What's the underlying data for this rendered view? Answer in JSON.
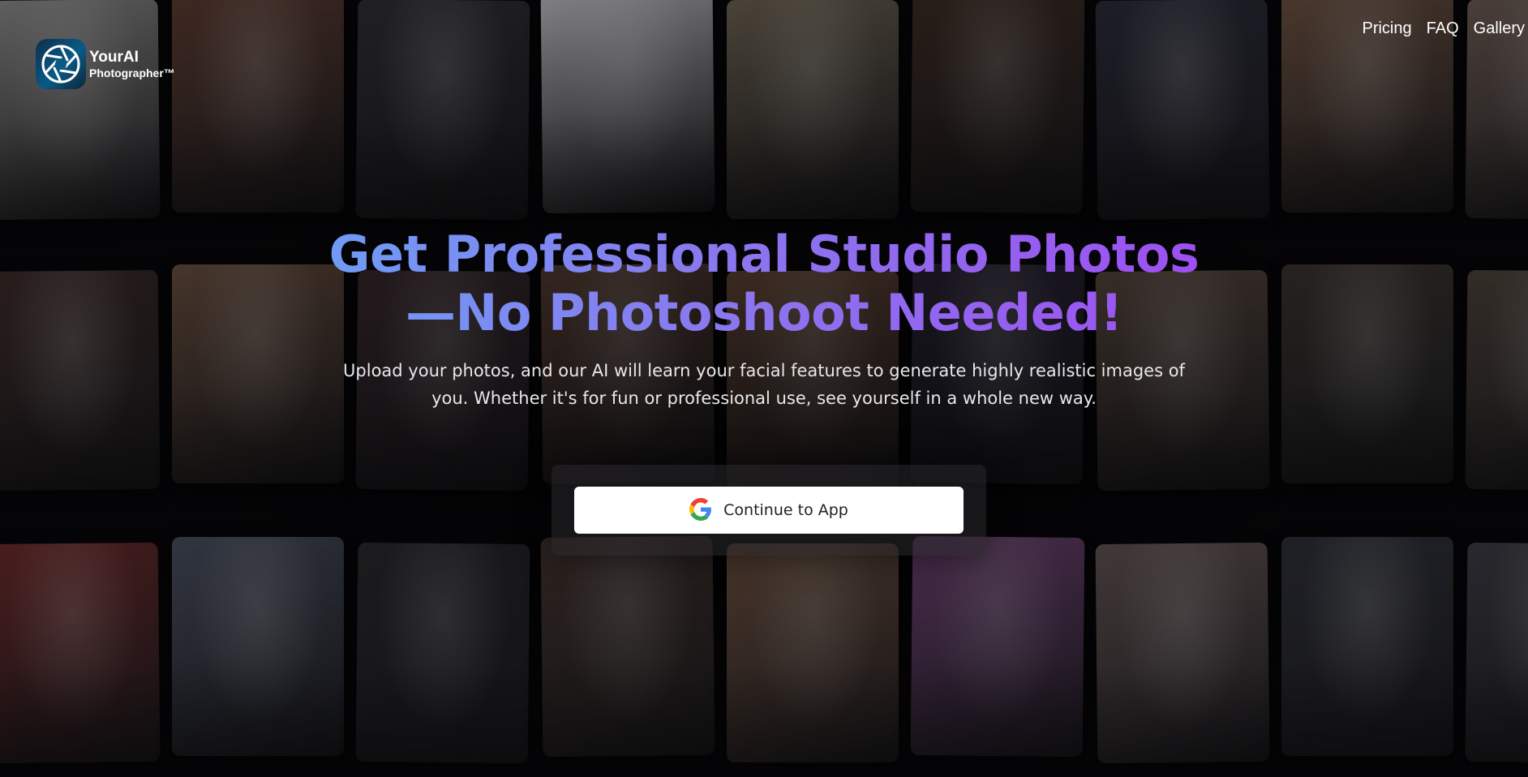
{
  "brand": {
    "name_line1": "YourAI",
    "name_line2": "Photographer™",
    "accent": "#0a5a86"
  },
  "nav": {
    "items": [
      {
        "label": "Pricing"
      },
      {
        "label": "FAQ"
      },
      {
        "label": "Gallery"
      }
    ]
  },
  "hero": {
    "headline_line1": "Get Professional Studio Photos",
    "headline_line2": "—No Photoshoot Needed!",
    "headline_gradient": [
      "#6f9cf5",
      "#9d4ff0"
    ],
    "subtext": "Upload your photos, and our AI will learn your facial features to generate highly realistic images of you. Whether it's for fun or professional use, see yourself in a whole new way."
  },
  "cta": {
    "label": "Continue to App",
    "icon": "google-icon"
  },
  "gallery": {
    "icon": "photo-tile",
    "tile_tones": [
      "#8a8a8a",
      "#3b2a28",
      "#6b2a2a",
      "#5a3a30",
      "#6a5040",
      "#4a5060",
      "#2e2e32",
      "#3a2a30",
      "#2c2c30",
      "#b8b8bc",
      "#5a4036",
      "#4a3a34",
      "#6a6050",
      "#6a4a3a",
      "#7a5a48",
      "#3a2a22",
      "#2a2436",
      "#7a4a80",
      "#2a2a38",
      "#5a4a40",
      "#6a5a5a",
      "#6a5040",
      "#3a3530",
      "#30323a",
      "#6a5a52",
      "#4a4038",
      "#3a3a42"
    ]
  }
}
